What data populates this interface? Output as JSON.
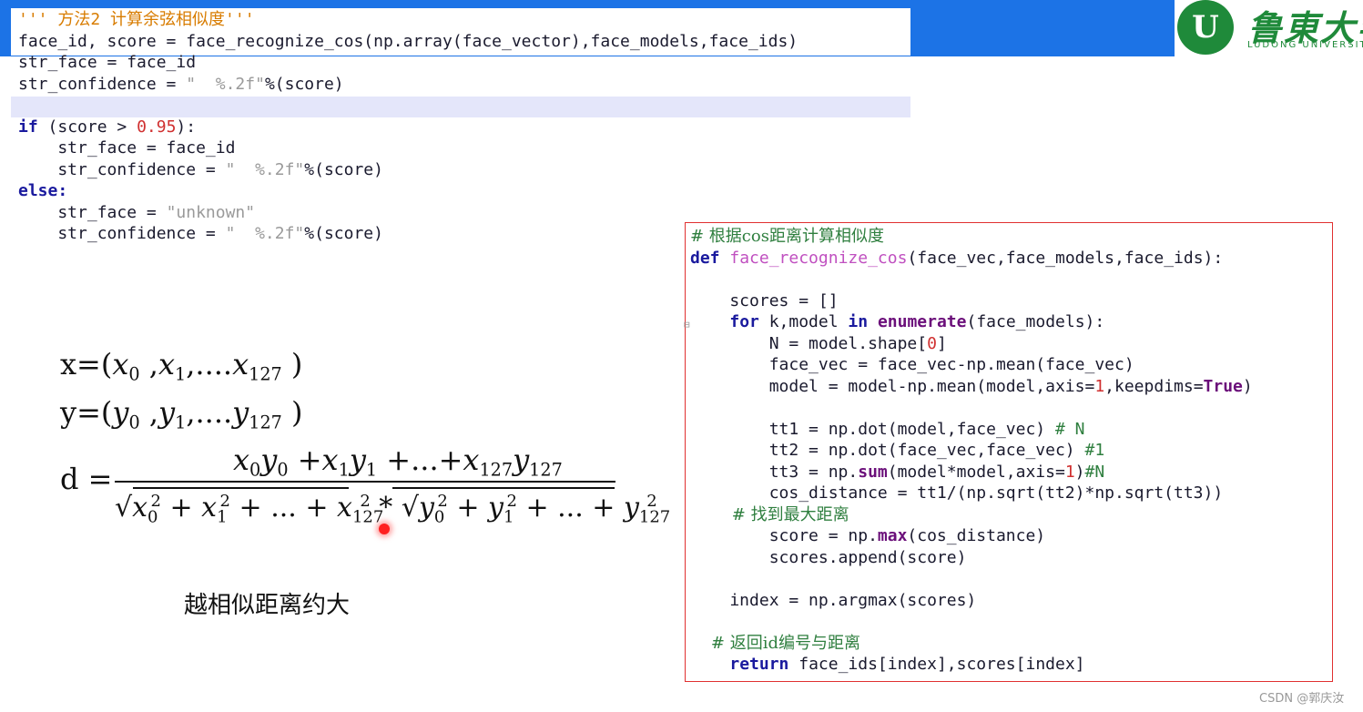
{
  "logo": {
    "emblem": "U",
    "name": "鲁東大学",
    "subtitle": "LUDONG UNIVERSITY",
    "brand_color": "#1f8a3a"
  },
  "top_code": {
    "l1_comment": "''' 方法2 计算余弦相似度'''",
    "l2": "face_id, score = face_recognize_cos(np.array(face_vector),face_models,face_ids)",
    "l3": "str_face = face_id",
    "l4_a": "str_confidence = ",
    "l4_str": "\"  %.2f\"",
    "l4_b": "%(score)",
    "l6_kw": "if",
    "l6_a": " (score > ",
    "l6_num": "0.95",
    "l6_b": "):",
    "l7": "    str_face = face_id",
    "l8_a": "    str_confidence = ",
    "l8_str": "\"  %.2f\"",
    "l8_b": "%(score)",
    "l9_kw": "else:",
    "l10_a": "    str_face = ",
    "l10_str": "\"unknown\"",
    "l11_a": "    str_confidence = ",
    "l11_str": "\"  %.2f\"",
    "l11_b": "%(score)"
  },
  "math": {
    "x_def_lhs": "x=(",
    "y_def_lhs": "y=(",
    "ellipsis": ",....",
    "d_lhs": "d =",
    "caption": "越相似距离约大"
  },
  "box_code": {
    "c1": "# 根据cos距离计算相似度",
    "def_kw": "def",
    "fn_name": "face_recognize_cos",
    "def_args": "(face_vec,face_models,face_ids):",
    "scores_init": "    scores = []",
    "for_kw": "for",
    "for_mid": " k,model ",
    "in_kw": "in",
    "enum_kw": "enumerate",
    "for_end": "(face_models):",
    "n_a": "        N = model.shape[",
    "n_num": "0",
    "n_b": "]",
    "fv": "        face_vec = face_vec-np.mean(face_vec)",
    "md_a": "        model = model-np.mean(model,axis=",
    "md_num": "1",
    "md_b": ",keepdims=",
    "md_true": "True",
    "md_c": ")",
    "tt1": "        tt1 = np.dot(model,face_vec) ",
    "tt1_c": "# N",
    "tt2": "        tt2 = np.dot(face_vec,face_vec) ",
    "tt2_c": "#1",
    "tt3_a": "        tt3 = np.",
    "tt3_sum": "sum",
    "tt3_b": "(model*model,axis=",
    "tt3_num": "1",
    "tt3_c": ")",
    "tt3_com": "#N",
    "cos": "        cos_distance = tt1/(np.sqrt(tt2)*np.sqrt(tt3))",
    "c2": "        # 找到最大距离",
    "sc_a": "        score = np.",
    "sc_max": "max",
    "sc_b": "(cos_distance)",
    "append": "        scores.append(score)",
    "index": "    index = np.argmax(scores)",
    "c3": "    # 返回id编号与距离",
    "ret_kw": "return",
    "ret": " face_ids[index],scores[index]"
  },
  "watermark": "CSDN @郭庆汝"
}
